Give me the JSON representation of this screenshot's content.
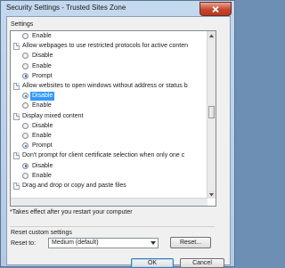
{
  "window": {
    "title": "Security Settings - Trusted Sites Zone"
  },
  "settings_label": "Settings",
  "tree": {
    "rows": [
      {
        "kind": "option",
        "label": "Enable",
        "selected": false
      },
      {
        "kind": "setting",
        "label": "Allow webpages to use restricted protocols for active conten"
      },
      {
        "kind": "option",
        "label": "Disable",
        "selected": false
      },
      {
        "kind": "option",
        "label": "Enable",
        "selected": false
      },
      {
        "kind": "option",
        "label": "Prompt",
        "selected": true
      },
      {
        "kind": "setting",
        "label": "Allow websites to open windows without address or status b"
      },
      {
        "kind": "option",
        "label": "Disable",
        "selected": true,
        "highlighted": true
      },
      {
        "kind": "option",
        "label": "Enable",
        "selected": false
      },
      {
        "kind": "setting",
        "label": "Display mixed content"
      },
      {
        "kind": "option",
        "label": "Disable",
        "selected": false
      },
      {
        "kind": "option",
        "label": "Enable",
        "selected": false
      },
      {
        "kind": "option",
        "label": "Prompt",
        "selected": true
      },
      {
        "kind": "setting",
        "label": "Don't prompt for client certificate selection when only one c"
      },
      {
        "kind": "option",
        "label": "Disable",
        "selected": true
      },
      {
        "kind": "option",
        "label": "Enable",
        "selected": false
      },
      {
        "kind": "setting",
        "label": "Drag and drop or copy and paste files"
      }
    ]
  },
  "note": "*Takes effect after you restart your computer",
  "reset": {
    "group_label": "Reset custom settings",
    "reset_to_label": "Reset to:",
    "select_value": "Medium (default)",
    "reset_button": "Reset..."
  },
  "footer": {
    "ok": "OK",
    "cancel": "Cancel"
  },
  "colors": {
    "selection": "#3399ff",
    "title_bar": "#c4d8ee",
    "close_button": "#c7452f"
  }
}
